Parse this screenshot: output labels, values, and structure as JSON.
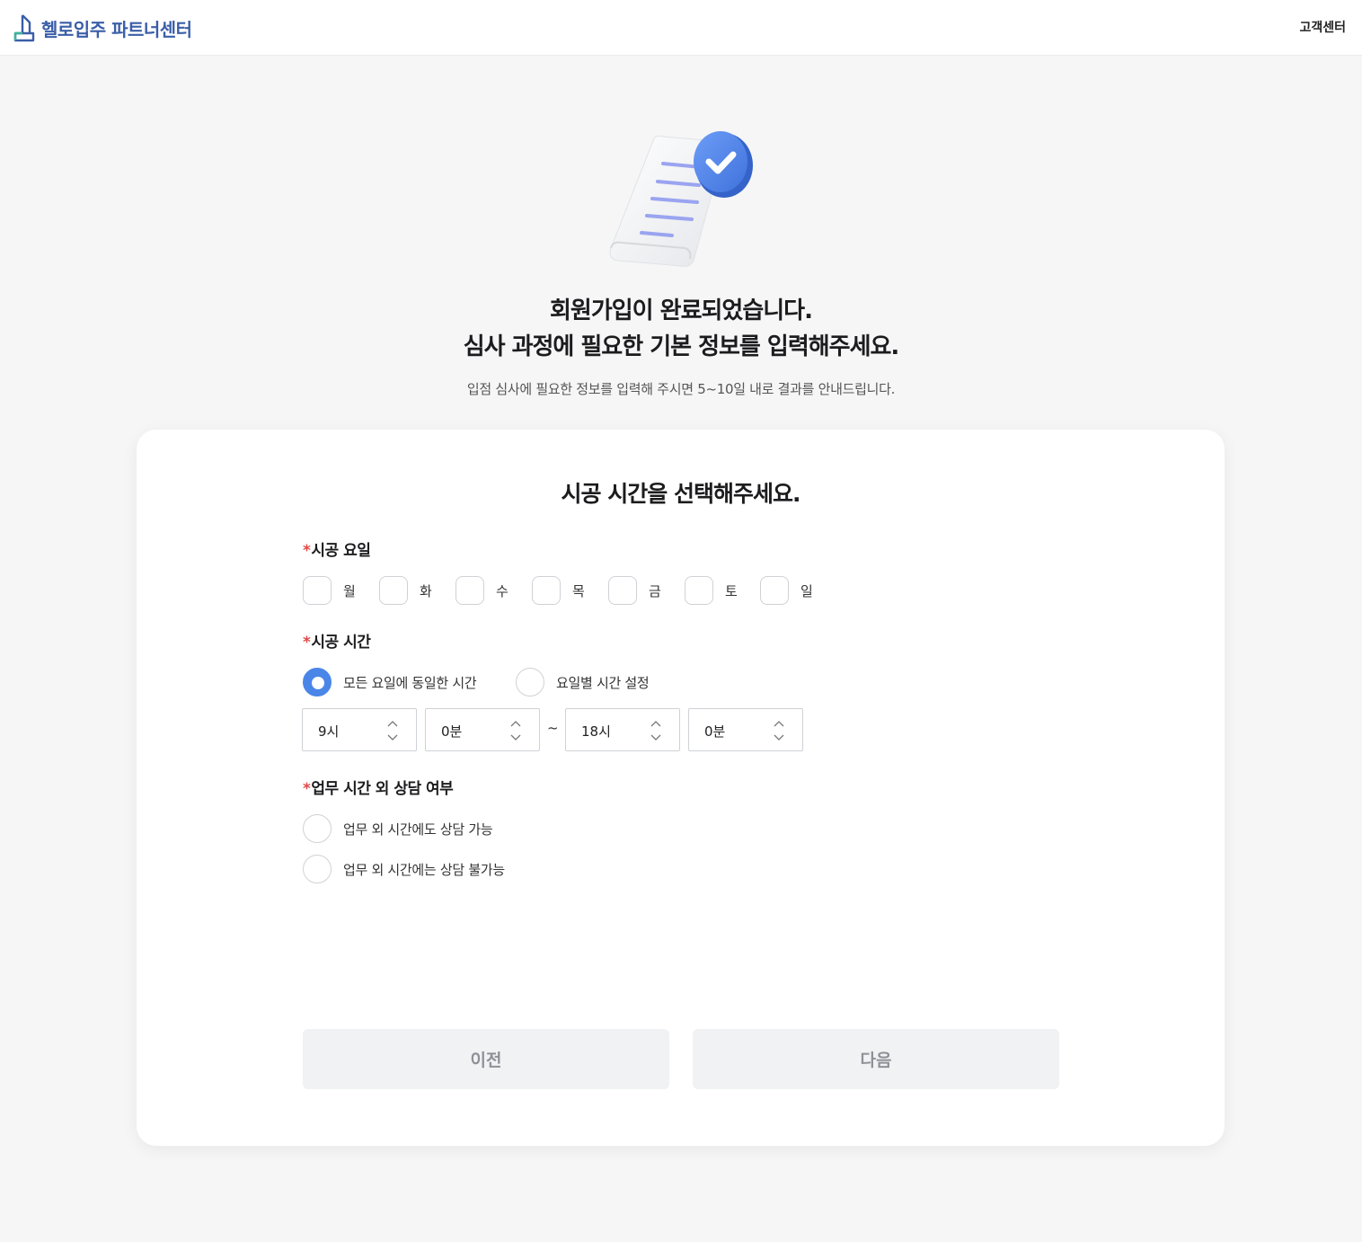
{
  "header": {
    "brand": "헬로입주 파트너센터",
    "customer_center": "고객센터"
  },
  "hero": {
    "headline_line1": "회원가입이 완료되었습니다.",
    "headline_line2": "심사 과정에 필요한 기본 정보를 입력해주세요.",
    "subline": "입점 심사에 필요한 정보를 입력해 주시면 5~10일 내로 결과를 안내드립니다."
  },
  "form": {
    "title": "시공 시간을 선택해주세요.",
    "required_mark": "*",
    "days_label": "시공 요일",
    "days": [
      {
        "label": "월",
        "checked": false
      },
      {
        "label": "화",
        "checked": false
      },
      {
        "label": "수",
        "checked": false
      },
      {
        "label": "목",
        "checked": false
      },
      {
        "label": "금",
        "checked": false
      },
      {
        "label": "토",
        "checked": false
      },
      {
        "label": "일",
        "checked": false
      }
    ],
    "time_label": "시공 시간",
    "time_modes": [
      {
        "label": "모든 요일에 동일한 시간",
        "checked": true
      },
      {
        "label": "요일별 시간 설정",
        "checked": false
      }
    ],
    "time_range": {
      "start_hour": "9시",
      "start_minute": "0분",
      "separator": "~",
      "end_hour": "18시",
      "end_minute": "0분"
    },
    "after_hours_label": "업무 시간 외 상담 여부",
    "after_hours_options": [
      {
        "label": "업무 외 시간에도 상담 가능",
        "checked": false
      },
      {
        "label": "업무 외 시간에는 상담 불가능",
        "checked": false
      }
    ]
  },
  "buttons": {
    "prev": "이전",
    "next": "다음"
  },
  "colors": {
    "brand": "#3a5ea8",
    "accent": "#4a86e8",
    "required": "#e04848"
  }
}
